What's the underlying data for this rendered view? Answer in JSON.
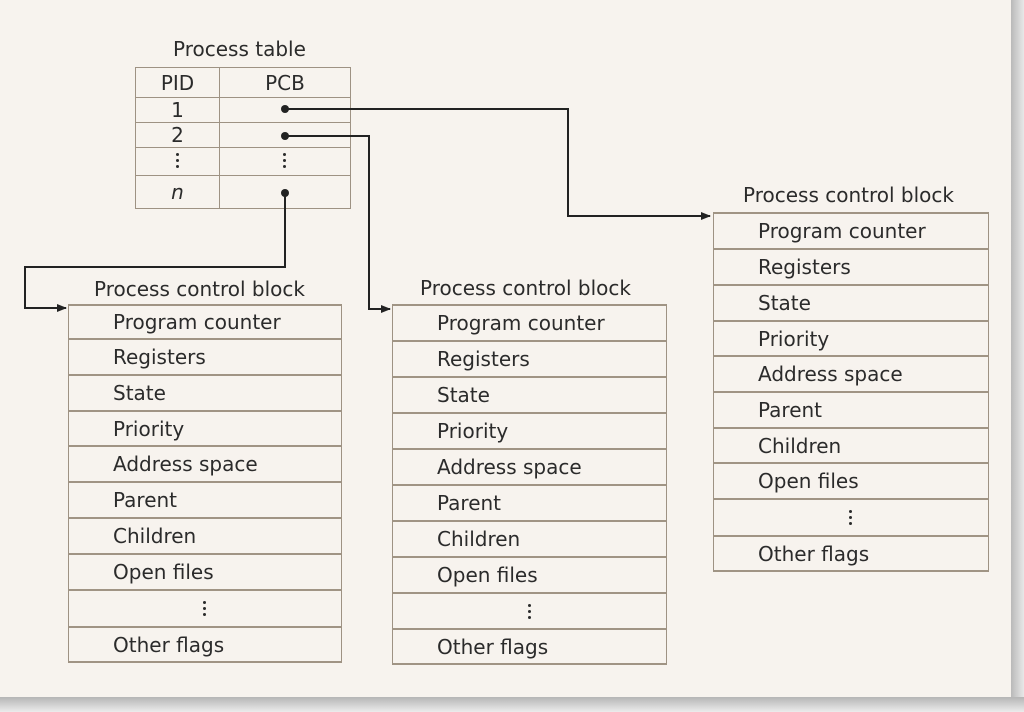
{
  "process_table": {
    "title": "Process table",
    "headers": [
      "PID",
      "PCB"
    ],
    "rows": [
      {
        "pid": "1",
        "pcb": "pointer"
      },
      {
        "pid": "2",
        "pcb": "pointer"
      },
      {
        "pid": "⋮",
        "pcb": "⋮"
      },
      {
        "pid": "n",
        "pcb": "pointer"
      }
    ]
  },
  "pcbs": [
    {
      "title": "Process control block",
      "fields": [
        "Program counter",
        "Registers",
        "State",
        "Priority",
        "Address space",
        "Parent",
        "Children",
        "Open files",
        "⋮",
        "Other flags"
      ],
      "linked_from_pid": "n"
    },
    {
      "title": "Process control block",
      "fields": [
        "Program counter",
        "Registers",
        "State",
        "Priority",
        "Address space",
        "Parent",
        "Children",
        "Open files",
        "⋮",
        "Other flags"
      ],
      "linked_from_pid": "2"
    },
    {
      "title": "Process control block",
      "fields": [
        "Program counter",
        "Registers",
        "State",
        "Priority",
        "Address space",
        "Parent",
        "Children",
        "Open files",
        "⋮",
        "Other flags"
      ],
      "linked_from_pid": "1"
    }
  ],
  "colors": {
    "paper": "#f7f3ee",
    "text": "#2b2b2b",
    "grid_line": "#a09484",
    "arrow": "#222222"
  }
}
